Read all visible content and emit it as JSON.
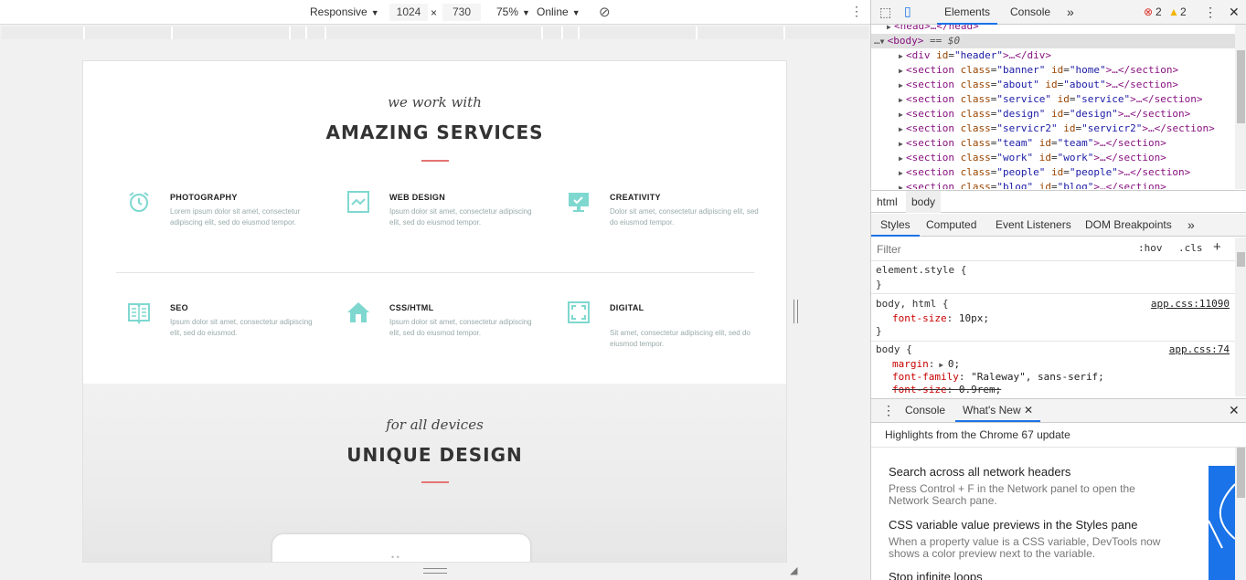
{
  "device_toolbar": {
    "device": "Responsive",
    "width": "1024",
    "times": "×",
    "height": "730",
    "zoom": "75%",
    "network": "Online"
  },
  "page": {
    "services": {
      "script": "we work with",
      "title": "AMAZING SERVICES",
      "items": [
        {
          "icon": "alarm-clock-icon",
          "title": "PHOTOGRAPHY",
          "desc": "Lorem ipsum dolor sit amet, consectetur adipiscing elit, sed do eiusmod tempor."
        },
        {
          "icon": "web-design-icon",
          "title": "WEB DESIGN",
          "desc": "Ipsum dolor sit amet, consectetur adipiscing\nelit, sed do eiusmod tempor."
        },
        {
          "icon": "monitor-icon",
          "title": "CREATIVITY",
          "desc": "Dolor sit amet, consectetur adipiscing elit, sed\ndo eiusmod tempor."
        },
        {
          "icon": "book-icon",
          "title": "SEO",
          "desc": "Ipsum dolor sit amet, consectetur adipiscing elit, sed do eiusmod."
        },
        {
          "icon": "house-icon",
          "title": "CSS/HTML",
          "desc": "Ipsum dolor sit amet, consectetur adipiscing\nelit, sed do eiusmod tempor."
        },
        {
          "icon": "fullscreen-icon",
          "title": "DIGITAL",
          "desc": "Sit amet, consectetur adipiscing elit, sed do eiusmod tempor."
        }
      ]
    },
    "design": {
      "script": "for all devices",
      "title": "UNIQUE DESIGN"
    },
    "accent_color": "#e57373",
    "icon_color": "#7fd8d0"
  },
  "devtools": {
    "tabs": {
      "elements": "Elements",
      "console": "Console",
      "more": "»"
    },
    "errors": "2",
    "warnings": "2",
    "tree": [
      {
        "indent": 1,
        "tag_open": "<head>",
        "rest": "…</head>"
      },
      {
        "indent": 0,
        "tag_open": "<body>",
        "rest": " == $0",
        "selected": true
      },
      {
        "indent": 2,
        "tag_open": "<div",
        "attr": "id",
        "val": "\"header\"",
        "rest": ">…</div>"
      },
      {
        "indent": 2,
        "tag_open": "<section",
        "attr": "class",
        "val": "\"banner\"",
        "attr2": "id",
        "val2": "\"home\"",
        "rest": ">…</section>"
      },
      {
        "indent": 2,
        "tag_open": "<section",
        "attr": "class",
        "val": "\"about\"",
        "attr2": "id",
        "val2": "\"about\"",
        "rest": ">…</section>"
      },
      {
        "indent": 2,
        "tag_open": "<section",
        "attr": "class",
        "val": "\"service\"",
        "attr2": "id",
        "val2": "\"service\"",
        "rest": ">…</section>"
      },
      {
        "indent": 2,
        "tag_open": "<section",
        "attr": "class",
        "val": "\"design\"",
        "attr2": "id",
        "val2": "\"design\"",
        "rest": ">…</section>"
      },
      {
        "indent": 2,
        "tag_open": "<section",
        "attr": "class",
        "val": "\"servicr2\"",
        "attr2": "id",
        "val2": "\"servicr2\"",
        "rest": ">…</section>"
      },
      {
        "indent": 2,
        "tag_open": "<section",
        "attr": "class",
        "val": "\"team\"",
        "attr2": "id",
        "val2": "\"team\"",
        "rest": ">…</section>"
      },
      {
        "indent": 2,
        "tag_open": "<section",
        "attr": "class",
        "val": "\"work\"",
        "attr2": "id",
        "val2": "\"work\"",
        "rest": ">…</section>"
      },
      {
        "indent": 2,
        "tag_open": "<section",
        "attr": "class",
        "val": "\"people\"",
        "attr2": "id",
        "val2": "\"people\"",
        "rest": ">…</section>"
      },
      {
        "indent": 2,
        "tag_open": "<section",
        "attr": "class",
        "val": "\"blog\"",
        "attr2": "id",
        "val2": "\"blog\"",
        "rest": ">…</section>"
      }
    ],
    "breadcrumbs": [
      "html",
      "body"
    ],
    "style_tabs": [
      "Styles",
      "Computed",
      "Event Listeners",
      "DOM Breakpoints",
      "»"
    ],
    "filter_placeholder": "Filter",
    "hov": ":hov",
    "cls": ".cls",
    "rules": {
      "element_style": "element.style {",
      "close": "}",
      "r1_selector": "body, html {",
      "r1_source": "app.css:11090",
      "r1_prop": "font-size",
      "r1_val": "10px;",
      "r2_selector": "body {",
      "r2_source": "app.css:74",
      "r2_p1": "margin",
      "r2_v1": "0;",
      "r2_p2": "font-family",
      "r2_v2": "\"Raleway\", sans-serif;",
      "r2_p3": "font-size",
      "r2_v3": "0.9rem;"
    },
    "drawer": {
      "console_tab": "Console",
      "whatsnew_tab": "What's New",
      "headline": "Highlights from the Chrome 67 update",
      "items": [
        {
          "title": "Search across all network headers",
          "desc": "Press Control + F in the Network panel to open the Network Search pane."
        },
        {
          "title": "CSS variable value previews in the Styles pane",
          "desc": "When a property value is a CSS variable, DevTools now shows a color preview next to the variable."
        },
        {
          "title": "Stop infinite loops",
          "desc": ""
        }
      ]
    }
  }
}
